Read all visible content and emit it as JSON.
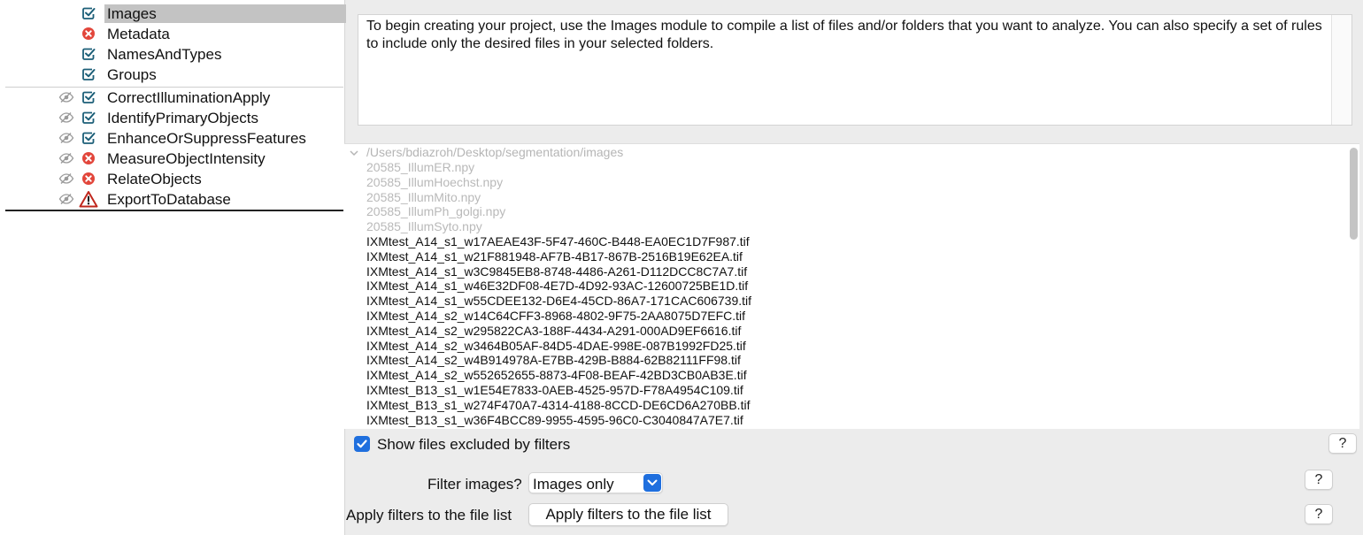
{
  "pipeline": {
    "input_modules": [
      {
        "name": "Images",
        "status": "check",
        "selected": true
      },
      {
        "name": "Metadata",
        "status": "error",
        "selected": false
      },
      {
        "name": "NamesAndTypes",
        "status": "check",
        "selected": false
      },
      {
        "name": "Groups",
        "status": "check",
        "selected": false
      }
    ],
    "analysis_modules": [
      {
        "name": "CorrectIlluminationApply",
        "status": "check"
      },
      {
        "name": "IdentifyPrimaryObjects",
        "status": "check"
      },
      {
        "name": "EnhanceOrSuppressFeatures",
        "status": "check"
      },
      {
        "name": "MeasureObjectIntensity",
        "status": "error"
      },
      {
        "name": "RelateObjects",
        "status": "error"
      },
      {
        "name": "ExportToDatabase",
        "status": "warning"
      }
    ]
  },
  "description": "To begin creating your project, use the Images module to compile a list of files and/or folders that you want to analyze. You can also specify a set of rules to include only the desired files in your selected folders.",
  "file_list": {
    "folder": "/Users/bdiazroh/Desktop/segmentation/images",
    "excluded_files": [
      "20585_IllumER.npy",
      "20585_IllumHoechst.npy",
      "20585_IllumMito.npy",
      "20585_IllumPh_golgi.npy",
      "20585_IllumSyto.npy"
    ],
    "included_files": [
      "IXMtest_A14_s1_w17AEAE43F-5F47-460C-B448-EA0EC1D7F987.tif",
      "IXMtest_A14_s1_w21F881948-AF7B-4B17-867B-2516B19E62EA.tif",
      "IXMtest_A14_s1_w3C9845EB8-8748-4486-A261-D112DCC8C7A7.tif",
      "IXMtest_A14_s1_w46E32DF08-4E7D-4D92-93AC-12600725BE1D.tif",
      "IXMtest_A14_s1_w55CDEE132-D6E4-45CD-86A7-171CAC606739.tif",
      "IXMtest_A14_s2_w14C64CFF3-8968-4802-9F75-2AA8075D7EFC.tif",
      "IXMtest_A14_s2_w295822CA3-188F-4434-A291-000AD9EF6616.tif",
      "IXMtest_A14_s2_w3464B05AF-84D5-4DAE-998E-087B1992FD25.tif",
      "IXMtest_A14_s2_w4B914978A-E7BB-429B-B884-62B82111FF98.tif",
      "IXMtest_A14_s2_w552652655-8873-4F08-BEAF-42BD3CB0AB3E.tif",
      "IXMtest_B13_s1_w1E54E7833-0AEB-4525-957D-F78A4954C109.tif",
      "IXMtest_B13_s1_w274F470A7-4314-4188-8CCD-DE6CD6A270BB.tif",
      "IXMtest_B13_s1_w36F4BCC89-9955-4595-96C0-C3040847A7E7.tif"
    ]
  },
  "controls": {
    "show_excluded_label": "Show files excluded by filters",
    "show_excluded_checked": true,
    "filter_label": "Filter images?",
    "filter_value": "Images only",
    "apply_label": "Apply filters to the file list",
    "apply_button": "Apply filters to the file list",
    "help": "?"
  },
  "colors": {
    "accent": "#1f6fde",
    "check": "#1c5f78",
    "error": "#e2463b",
    "warning": "#c0271d",
    "selection": "#c3c3c3"
  }
}
